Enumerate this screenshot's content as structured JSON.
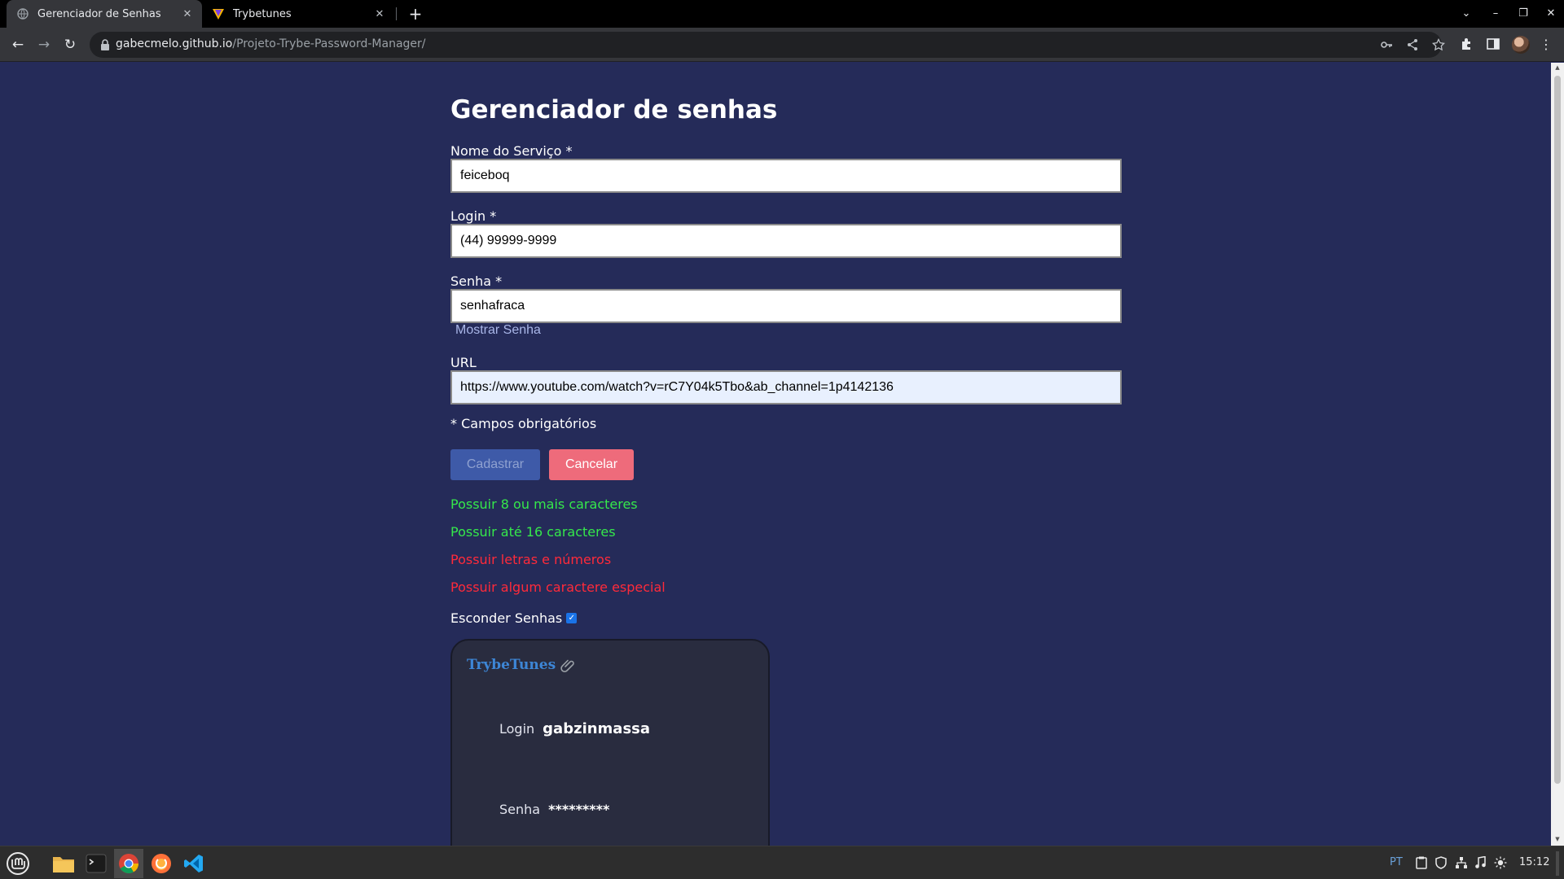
{
  "browser": {
    "tabs": [
      {
        "title": "Gerenciador de Senhas",
        "active": true
      },
      {
        "title": "Trybetunes",
        "active": false
      }
    ],
    "url_host": "gabecmelo.github.io",
    "url_path": "/Projeto-Trybe-Password-Manager/"
  },
  "form": {
    "title": "Gerenciador de senhas",
    "service_label": "Nome do Serviço *",
    "service_value": "feiceboq",
    "login_label": "Login *",
    "login_value": "(44) 99999-9999",
    "password_label": "Senha *",
    "password_value": "senhafraca",
    "show_password_label": "Mostrar Senha",
    "url_label": "URL",
    "url_value": "https://www.youtube.com/watch?v=rC7Y04k5Tbo&ab_channel=1p4142136",
    "required_note": "* Campos obrigatórios",
    "submit_label": "Cadastrar",
    "cancel_label": "Cancelar"
  },
  "validation": [
    {
      "text": "Possuir 8 ou mais caracteres",
      "valid": true
    },
    {
      "text": "Possuir até 16 caracteres",
      "valid": true
    },
    {
      "text": "Possuir letras e números",
      "valid": false
    },
    {
      "text": "Possuir algum caractere especial",
      "valid": false
    }
  ],
  "hide_passwords": {
    "label": "Esconder Senhas",
    "checked": true
  },
  "entries": [
    {
      "service": "TrybeTunes",
      "login_label": "Login",
      "login": "gabzinmassa",
      "password_label": "Senha",
      "password": "*********"
    }
  ],
  "system": {
    "lang": "PT",
    "clock": "15:12"
  },
  "colors": {
    "page_bg": "#252b59",
    "valid": "#35e84b",
    "invalid": "#ff2a3a",
    "cancel": "#ee6b7b",
    "submit": "#3e5aa8",
    "card_link": "#3d86d6"
  }
}
